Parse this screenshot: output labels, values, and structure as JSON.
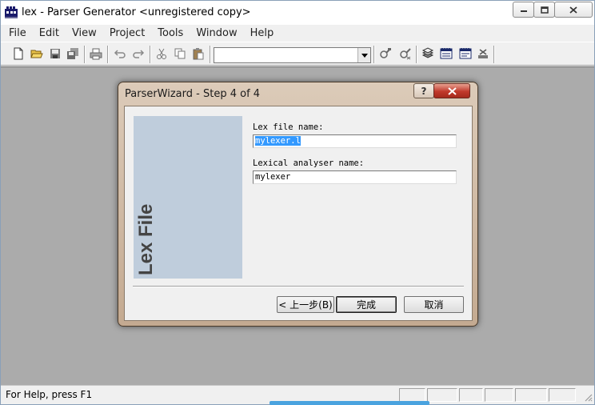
{
  "window": {
    "title": "lex - Parser Generator <unregistered copy>"
  },
  "menu": [
    "File",
    "Edit",
    "View",
    "Project",
    "Tools",
    "Window",
    "Help"
  ],
  "toolbar": {
    "icons": [
      "new-file-icon",
      "open-folder-icon",
      "save-icon",
      "save-all-icon",
      "print-icon",
      "undo-icon",
      "redo-icon",
      "cut-icon",
      "copy-icon",
      "paste-icon",
      "compile-icon",
      "build-icon",
      "project-icon",
      "output-window-icon",
      "log-window-icon",
      "stop-icon"
    ],
    "combo_value": ""
  },
  "dialog": {
    "title": "ParserWizard - Step 4 of 4",
    "help_glyph": "?",
    "side_panel_text": "Lex File",
    "lex_file_label": "Lex file name:",
    "lex_file_value": "mylexer.l",
    "analyser_label": "Lexical analyser name:",
    "analyser_value": "mylexer",
    "back_button": "< 上一步(B)",
    "finish_button": "完成",
    "cancel_button": "取消"
  },
  "status": {
    "text": "For Help, press F1"
  },
  "colors": {
    "client_bg": "#ababab",
    "side_panel": "#bfcddc",
    "dialog_frame": "#c4aa91",
    "selection": "#3399ff",
    "close_button": "#c0392b"
  }
}
